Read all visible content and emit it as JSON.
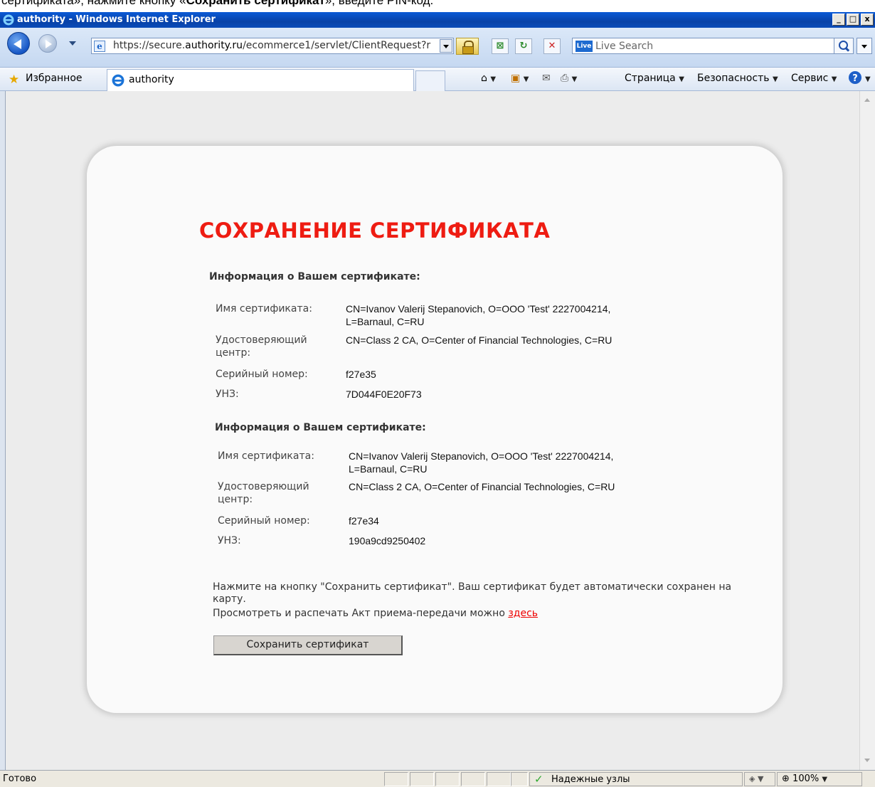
{
  "top_instruction": {
    "text_prefix": "сертификата», нажмите кнопку «",
    "text_bold": "Сохранить сертификат",
    "text_suffix": "», введите PIN-код."
  },
  "window": {
    "title": "authority - Windows Internet Explorer",
    "minimize": "_",
    "maximize": "□",
    "close": "x"
  },
  "address_bar": {
    "url_prefix": "https://secure.",
    "url_domain": "authority.ru",
    "url_suffix": "/ecommerce1/servlet/ClientRequest?r",
    "search_placeholder": "Live Search",
    "live_badge": "Live"
  },
  "favorites_bar": {
    "favorites_label": "Избранное",
    "tab_title": "authority",
    "page_menu": "Страница",
    "safety_menu": "Безопасность",
    "tools_menu": "Сервис"
  },
  "page": {
    "heading": "СОХРАНЕНИЕ СЕРТИФИКАТА",
    "certificates": [
      {
        "section_title": "Информация о Вашем сертификате:",
        "name_label": "Имя сертификата:",
        "name_value": "CN=Ivanov Valerij Stepanovich, O=ООО 'Test' 2227004214, L=Barnaul, C=RU",
        "ca_label": "Удостоверяющий центр:",
        "ca_value": "CN=Class 2 CA, O=Center of Financial Technologies, C=RU",
        "serial_label": "Серийный номер:",
        "serial_value": "f27e35",
        "unz_label": "УНЗ:",
        "unz_value": "7D044F0E20F73"
      },
      {
        "section_title": "Информация о Вашем сертификате:",
        "name_label": "Имя сертификата:",
        "name_value": "CN=Ivanov Valerij Stepanovich, O=ООО 'Test' 2227004214, L=Barnaul, C=RU",
        "ca_label": "Удостоверяющий центр:",
        "ca_value": "CN=Class 2 CA, O=Center of Financial Technologies, C=RU",
        "serial_label": "Серийный номер:",
        "serial_value": "f27e34",
        "unz_label": "УНЗ:",
        "unz_value": "190a9cd9250402"
      }
    ],
    "note_line1": "Нажмите на кнопку \"Сохранить сертификат\". Ваш сертификат будет автоматически сохранен на карту.",
    "note_line2_prefix": "Просмотреть и распечать Акт приема-передачи можно ",
    "note_link": "здесь",
    "save_button": "Сохранить сертификат"
  },
  "status_bar": {
    "status_text": "Готово",
    "zone_text": "Надежные узлы",
    "zoom": "100%"
  },
  "colors": {
    "heading_red": "#ee1c12",
    "titlebar_blue": "#0a4bb8",
    "link_red": "#e00000"
  }
}
